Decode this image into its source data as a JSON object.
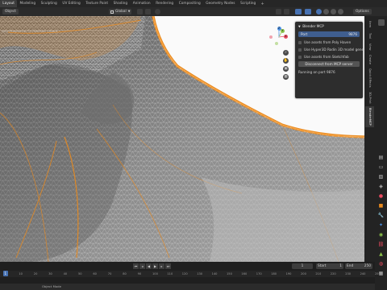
{
  "topbar": {
    "tabs": [
      "Layout",
      "Modeling",
      "Sculpting",
      "UV Editing",
      "Texture Paint",
      "Shading",
      "Animation",
      "Rendering",
      "Compositing",
      "Geometry Nodes",
      "Scripting"
    ],
    "active_tab": "Layout"
  },
  "toolbar": {
    "mode_label": "Object",
    "transform_orientation": "Global",
    "options_label": "Options"
  },
  "viewport": {
    "overlay_text": "User Perspective (1) Collection | Scene",
    "gizmo_axes": {
      "x": "X",
      "y": "Y",
      "z": "Z"
    }
  },
  "sidebar_tabs": [
    "Item",
    "Tool",
    "View",
    "Create",
    "Quick Effects",
    "3D-Print",
    "BlenderMCP"
  ],
  "mcp_panel": {
    "title": "Blender MCP",
    "port_label": "Port",
    "port_value": "9876",
    "options": [
      "Use assets from Poly Haven",
      "Use Hyper3D Rodin 3D model gene...",
      "Use assets from Sketchfab"
    ],
    "disconnect_label": "Disconnect from MCP server",
    "status": "Running on port 9876"
  },
  "timeline": {
    "ticks": [
      "0",
      "10",
      "20",
      "30",
      "40",
      "50",
      "60",
      "70",
      "80",
      "90",
      "100",
      "110",
      "120",
      "130",
      "140",
      "150",
      "160",
      "170",
      "180",
      "190",
      "200",
      "210",
      "220",
      "230",
      "240",
      "250"
    ],
    "current_frame": "1",
    "start_label": "Start",
    "start_value": "1",
    "end_label": "End",
    "end_value": "250"
  },
  "statusbar": {
    "hint": "Object Mode"
  },
  "colors": {
    "accent": "#e8891e",
    "selection": "#ff9a1f",
    "ui_bg": "#2b2b2b"
  }
}
